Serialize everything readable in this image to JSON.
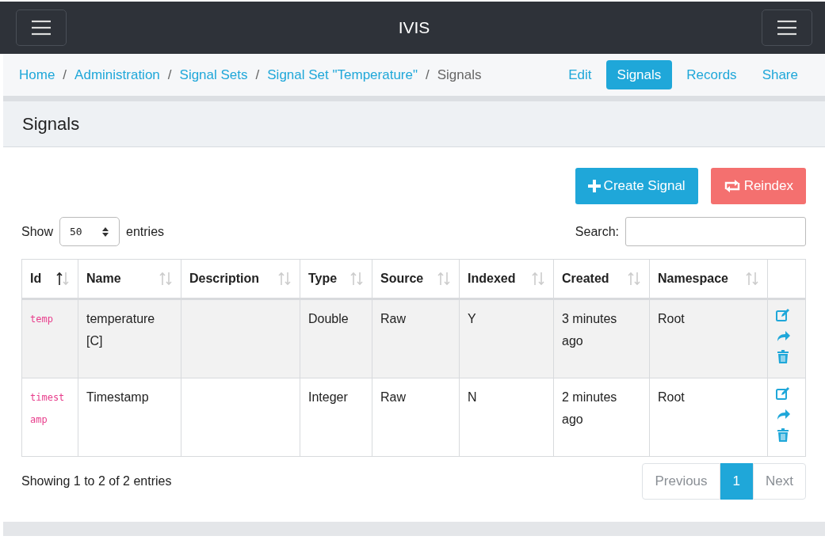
{
  "navbar": {
    "title": "IVIS"
  },
  "breadcrumb": [
    {
      "label": "Home",
      "link": true
    },
    {
      "separator": "/",
      "label": "Administration",
      "link": true
    },
    {
      "separator": "/",
      "label": "Signal Sets",
      "link": true
    },
    {
      "separator": "/",
      "label": "Signal Set \"Temperature\"",
      "link": true
    },
    {
      "separator": "/",
      "label": "Signals",
      "link": false
    }
  ],
  "secondary_nav": [
    {
      "label": "Edit",
      "selected": false
    },
    {
      "label": "Signals",
      "selected": true
    },
    {
      "label": "Records",
      "selected": false
    },
    {
      "label": "Share",
      "selected": false
    }
  ],
  "panel_title": "Signals",
  "actions": [
    {
      "label": "Create Signal",
      "kind": "create"
    },
    {
      "label": "Reindex",
      "kind": "reindex"
    }
  ],
  "length": {
    "before": "Show",
    "value": "50",
    "after": "entries"
  },
  "search": {
    "label": "Search:"
  },
  "table": {
    "columns": [
      {
        "label": "Id",
        "sorted": true
      },
      {
        "label": "Name",
        "sorted": false
      },
      {
        "label": "Description",
        "sorted": false
      },
      {
        "label": "Type",
        "sorted": false
      },
      {
        "label": "Source",
        "sorted": false
      },
      {
        "label": "Indexed",
        "sorted": false
      },
      {
        "label": "Created",
        "sorted": false
      },
      {
        "label": "Namespace",
        "sorted": false
      }
    ],
    "rows": [
      {
        "highlighted": true,
        "cells": [
          "temp",
          "temperature [C]",
          "",
          "Double",
          "Raw",
          "Y",
          "3 minutes ago",
          "Root"
        ]
      },
      {
        "highlighted": false,
        "cells": [
          "timestamp",
          "Timestamp",
          "",
          "Integer",
          "Raw",
          "N",
          "2 minutes ago",
          "Root"
        ]
      }
    ]
  },
  "info": "Showing 1 to 2 of 2 entries",
  "pagination": [
    {
      "label": "Previous",
      "selected": false,
      "disabled": true
    },
    {
      "label": "1",
      "selected": true,
      "disabled": false
    },
    {
      "label": "Next",
      "selected": false,
      "disabled": true
    }
  ]
}
